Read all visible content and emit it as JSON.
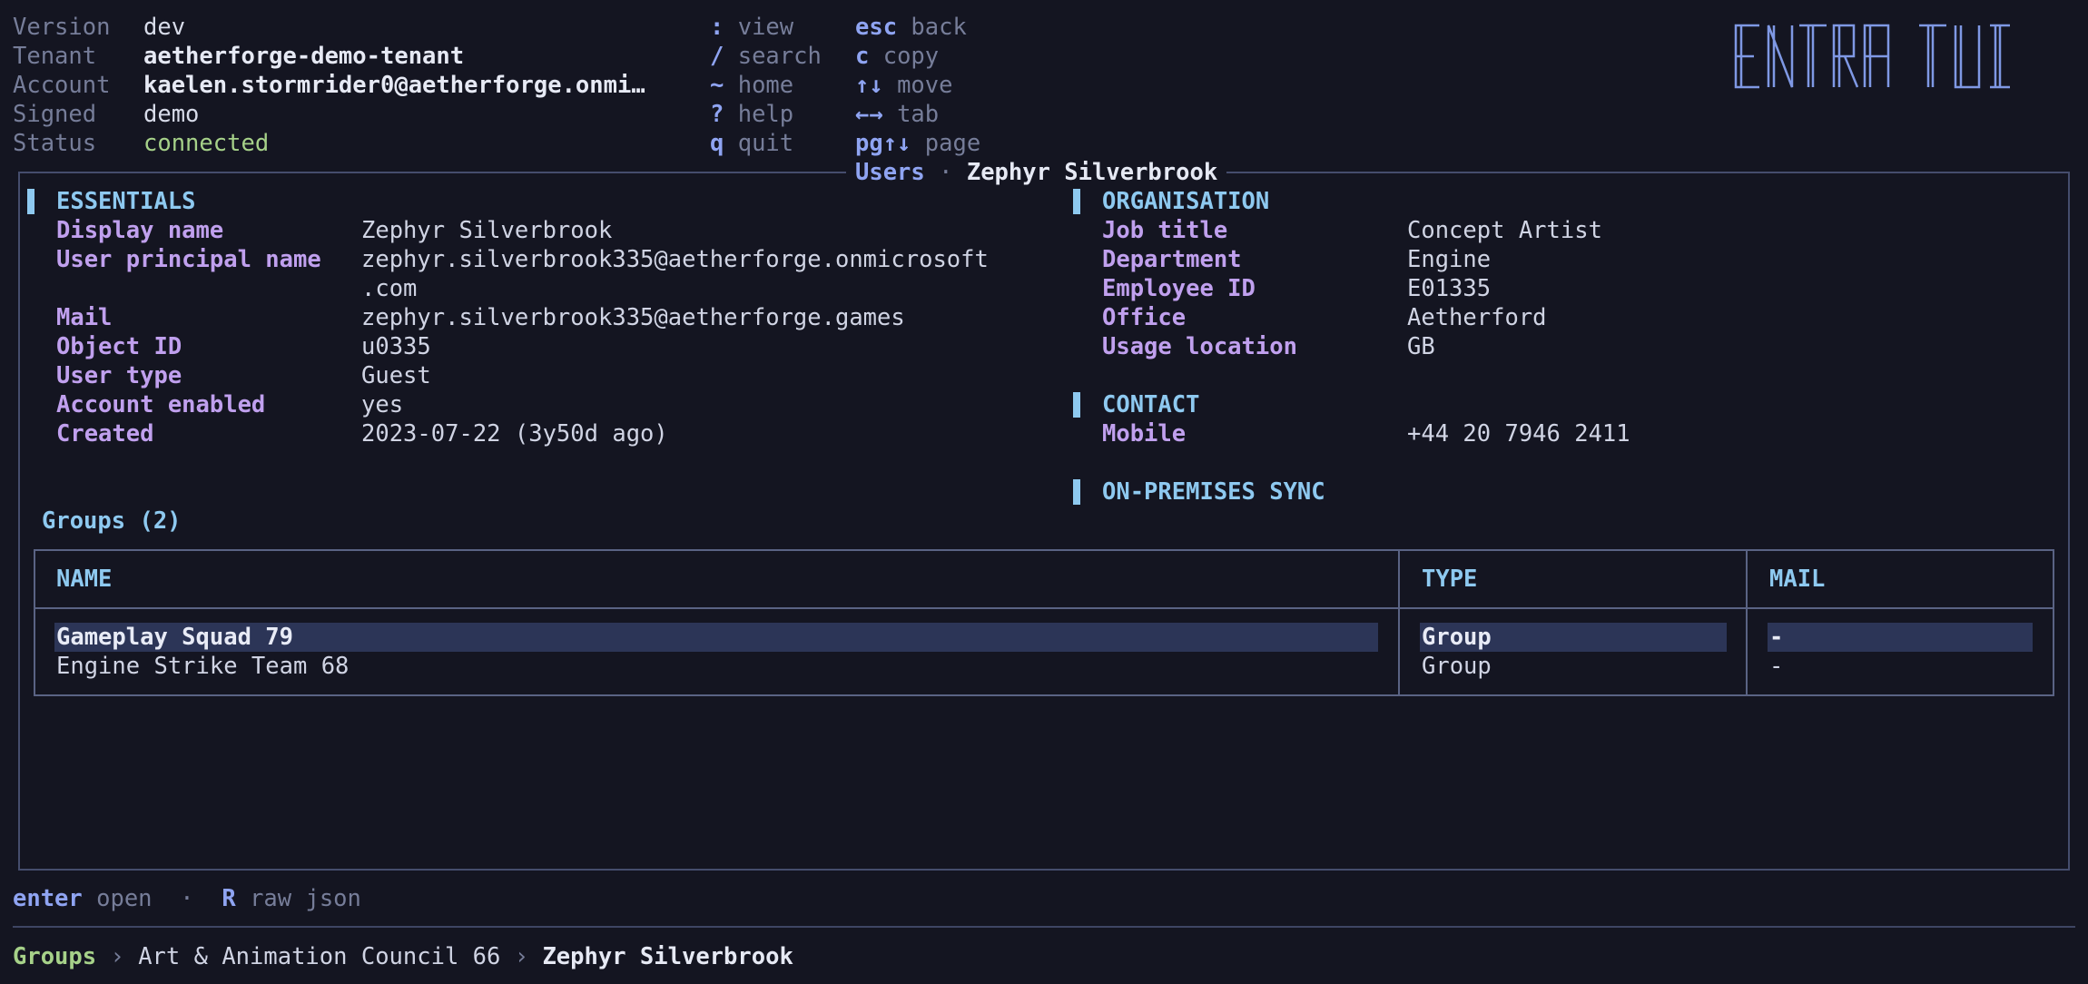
{
  "header": {
    "info": [
      {
        "label": "Version",
        "value": "dev",
        "style": "plain"
      },
      {
        "label": "Tenant",
        "value": "aetherforge-demo-tenant",
        "style": "bold"
      },
      {
        "label": "Account",
        "value": "kaelen.stormrider0@aetherforge.onmi…",
        "style": "bold"
      },
      {
        "label": "Signed",
        "value": "demo",
        "style": "plain"
      },
      {
        "label": "Status",
        "value": "connected",
        "style": "ok"
      }
    ],
    "shortcuts_col1": [
      {
        "key": ":",
        "label": "view"
      },
      {
        "key": "/",
        "label": "search"
      },
      {
        "key": "~",
        "label": "home"
      },
      {
        "key": "?",
        "label": "help"
      },
      {
        "key": "q",
        "label": "quit"
      }
    ],
    "shortcuts_col2": [
      {
        "key": "esc",
        "label": "back"
      },
      {
        "key": "c",
        "label": "copy"
      },
      {
        "key": "↑↓",
        "label": "move"
      },
      {
        "key": "←→",
        "label": "tab"
      },
      {
        "key": "pg↑↓",
        "label": "page"
      }
    ],
    "logo_text": "ENTRA TUI"
  },
  "panel": {
    "section": "Users",
    "separator": "·",
    "subject": "Zephyr Silverbrook"
  },
  "essentials": {
    "title": "ESSENTIALS",
    "fields": [
      {
        "label": "Display name",
        "value": "Zephyr Silverbrook"
      },
      {
        "label": "User principal name",
        "value": "zephyr.silverbrook335@aetherforge.onmicrosoft",
        "value_cont": ".com"
      },
      {
        "label": "Mail",
        "value": "zephyr.silverbrook335@aetherforge.games"
      },
      {
        "label": "Object ID",
        "value": "u0335"
      },
      {
        "label": "User type",
        "value": "Guest"
      },
      {
        "label": "Account enabled",
        "value": "yes"
      },
      {
        "label": "Created",
        "value": "2023-07-22 (3y50d ago)"
      }
    ]
  },
  "organisation": {
    "title": "ORGANISATION",
    "fields": [
      {
        "label": "Job title",
        "value": "Concept Artist"
      },
      {
        "label": "Department",
        "value": "Engine"
      },
      {
        "label": "Employee ID",
        "value": "E01335"
      },
      {
        "label": "Office",
        "value": "Aetherford"
      },
      {
        "label": "Usage location",
        "value": "GB"
      }
    ]
  },
  "contact": {
    "title": "CONTACT",
    "fields": [
      {
        "label": "Mobile",
        "value": "+44 20 7946 2411"
      }
    ]
  },
  "onprem": {
    "title": "ON-PREMISES SYNC"
  },
  "groups": {
    "title": "Groups (2)",
    "columns": [
      "NAME",
      "TYPE",
      "MAIL"
    ],
    "rows": [
      {
        "name": "Gameplay Squad 79",
        "type": "Group",
        "mail": "-",
        "selected": true
      },
      {
        "name": "Engine Strike Team 68",
        "type": "Group",
        "mail": "-",
        "selected": false
      }
    ]
  },
  "footer": {
    "hints": [
      {
        "key": "enter",
        "label": "open"
      },
      {
        "sep": "·"
      },
      {
        "key": "R",
        "label": "raw json"
      }
    ],
    "breadcrumb": [
      "Groups",
      "Art & Animation Council 66",
      "Zephyr Silverbrook"
    ],
    "breadcrumb_sep": "›"
  },
  "colors": {
    "background": "#141521",
    "accent": "#8ec9f0",
    "field_label": "#c0a0ee",
    "key": "#8fa4f2",
    "ok": "#a6d189",
    "selection": "#2c3557"
  }
}
